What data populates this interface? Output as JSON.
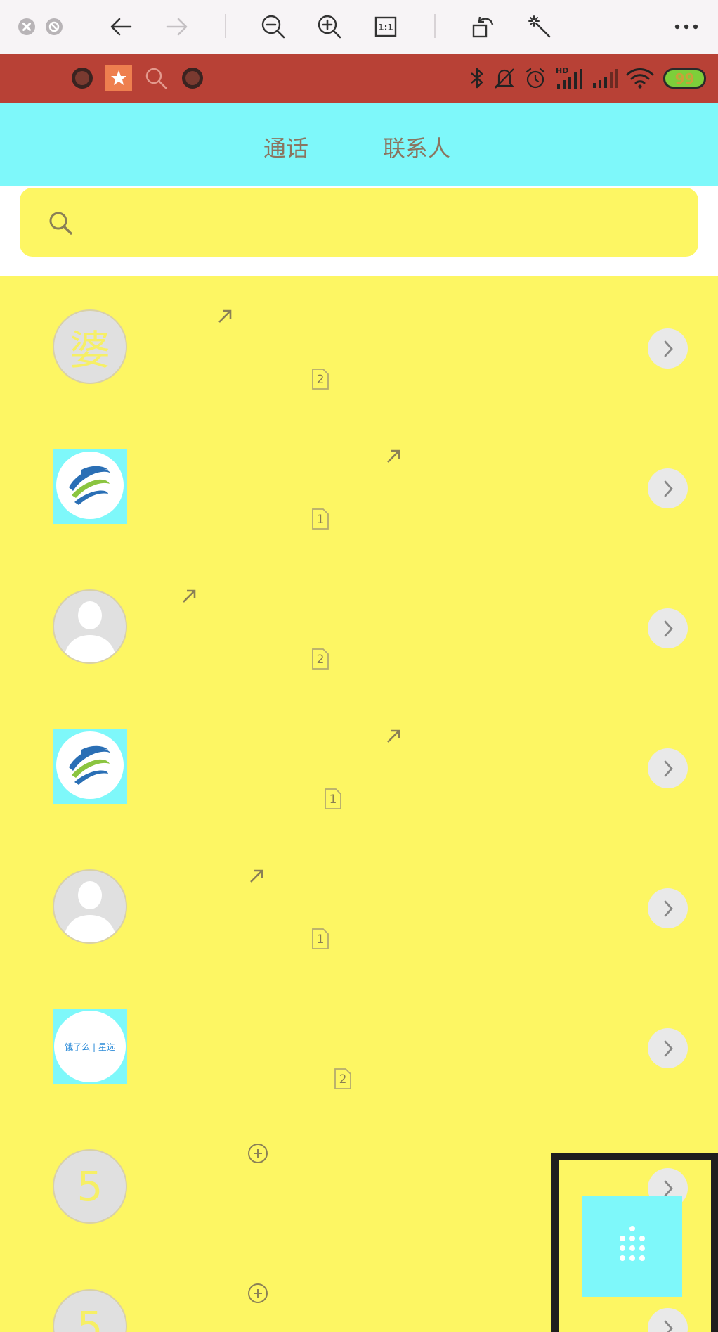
{
  "viewer_toolbar": {
    "items": [
      {
        "name": "close-icon"
      },
      {
        "name": "stop-icon"
      },
      {
        "name": "back-arrow-icon"
      },
      {
        "name": "forward-arrow-icon"
      },
      {
        "name": "zoom-out-icon"
      },
      {
        "name": "zoom-in-icon"
      },
      {
        "name": "actual-size-icon",
        "label": "1:1"
      },
      {
        "name": "rotate-icon"
      },
      {
        "name": "magic-wand-icon"
      },
      {
        "name": "more-icon"
      }
    ]
  },
  "status_bar": {
    "left_icons": [
      "record-icon",
      "star-app-icon",
      "search-icon",
      "record-icon"
    ],
    "right_icons": [
      "bluetooth-icon",
      "mute-bell-icon",
      "alarm-icon",
      "hd-signal-icon",
      "signal-icon",
      "wifi-icon"
    ],
    "hd_label": "HD",
    "battery": "99",
    "colors": {
      "background": "#b84136",
      "battery_fill": "#7dcf3a"
    }
  },
  "tabs": {
    "items": [
      {
        "label": "通话"
      },
      {
        "label": "联系人"
      }
    ],
    "background": "#7ef8fa"
  },
  "search": {
    "icon": "search-icon",
    "placeholder": ""
  },
  "call_log": {
    "rows": [
      {
        "avatar": {
          "type": "char",
          "text": "婆"
        },
        "direction": "outgoing-arrow-icon",
        "sim": "2"
      },
      {
        "avatar": {
          "type": "logo",
          "icon": "china-mobile-logo-icon"
        },
        "direction": "outgoing-arrow-icon",
        "sim": "1"
      },
      {
        "avatar": {
          "type": "default",
          "icon": "person-silhouette-icon"
        },
        "direction": "outgoing-arrow-icon",
        "sim": "2"
      },
      {
        "avatar": {
          "type": "logo",
          "icon": "china-mobile-logo-icon"
        },
        "direction": "outgoing-arrow-icon",
        "sim": "1"
      },
      {
        "avatar": {
          "type": "default",
          "icon": "person-silhouette-icon"
        },
        "direction": "outgoing-arrow-icon",
        "sim": "1"
      },
      {
        "avatar": {
          "type": "logo",
          "icon": "eleme-logo-icon",
          "text": "饿了么 | 星选"
        },
        "direction": "",
        "sim": "2"
      },
      {
        "avatar": {
          "type": "char",
          "text": "5"
        },
        "direction": "add-circle-icon",
        "sim": ""
      },
      {
        "avatar": {
          "type": "char",
          "text": "5"
        },
        "direction": "add-circle-icon",
        "sim": ""
      }
    ],
    "detail_icon": "chevron-right-icon",
    "background": "#fdf663"
  },
  "dial_button": {
    "icon": "dialpad-icon",
    "background": "#7ef8fa",
    "highlighted": true
  }
}
